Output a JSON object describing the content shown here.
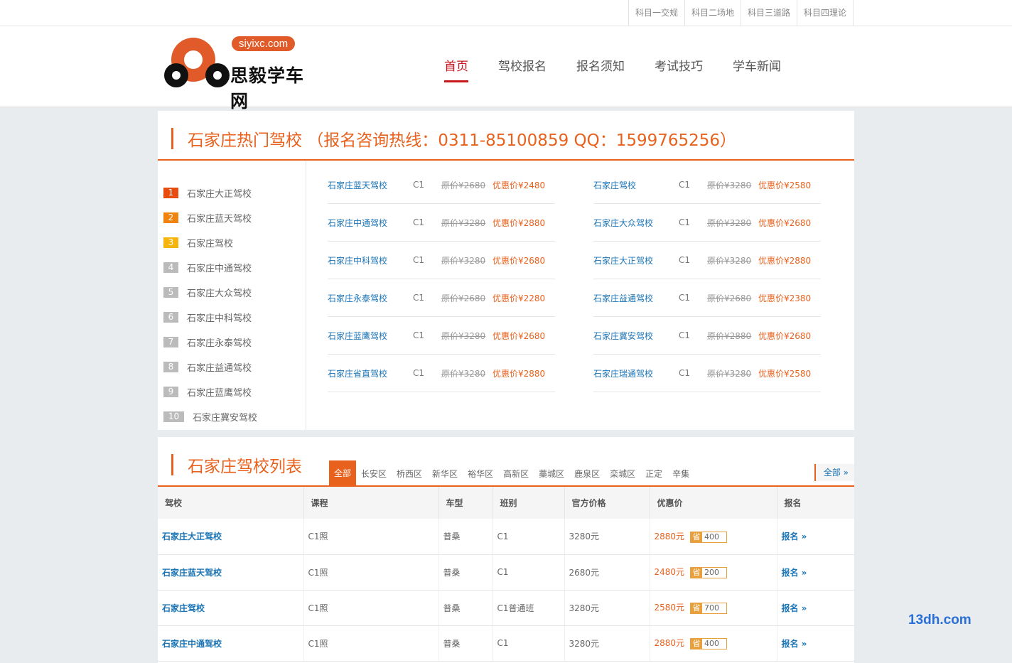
{
  "topbar": {
    "links": [
      "科目一交规",
      "科目二场地",
      "科目三道路",
      "科目四理论"
    ]
  },
  "logo": {
    "domain": "siyixc.com",
    "name": "思毅学车网"
  },
  "nav": {
    "items": [
      "首页",
      "驾校报名",
      "报名须知",
      "考试技巧",
      "学车新闻"
    ],
    "active": "首页"
  },
  "hot": {
    "title": "石家庄热门驾校 （报名咨询热线：0311-85100859 QQ：1599765256）",
    "ranking": [
      {
        "n": "1",
        "name": "石家庄大正驾校"
      },
      {
        "n": "2",
        "name": "石家庄蓝天驾校"
      },
      {
        "n": "3",
        "name": "石家庄驾校"
      },
      {
        "n": "4",
        "name": "石家庄中通驾校"
      },
      {
        "n": "5",
        "name": "石家庄大众驾校"
      },
      {
        "n": "6",
        "name": "石家庄中科驾校"
      },
      {
        "n": "7",
        "name": "石家庄永泰驾校"
      },
      {
        "n": "8",
        "name": "石家庄益通驾校"
      },
      {
        "n": "9",
        "name": "石家庄蓝鹰驾校"
      },
      {
        "n": "10",
        "name": "石家庄冀安驾校"
      }
    ],
    "offers": [
      {
        "name": "石家庄蓝天驾校",
        "cls": "C1",
        "orig": "原价¥2680",
        "disc": "优惠价¥2480"
      },
      {
        "name": "石家庄驾校",
        "cls": "C1",
        "orig": "原价¥3280",
        "disc": "优惠价¥2580"
      },
      {
        "name": "石家庄中通驾校",
        "cls": "C1",
        "orig": "原价¥3280",
        "disc": "优惠价¥2880"
      },
      {
        "name": "石家庄大众驾校",
        "cls": "C1",
        "orig": "原价¥3280",
        "disc": "优惠价¥2680"
      },
      {
        "name": "石家庄中科驾校",
        "cls": "C1",
        "orig": "原价¥3280",
        "disc": "优惠价¥2680"
      },
      {
        "name": "石家庄大正驾校",
        "cls": "C1",
        "orig": "原价¥3280",
        "disc": "优惠价¥2880"
      },
      {
        "name": "石家庄永泰驾校",
        "cls": "C1",
        "orig": "原价¥2680",
        "disc": "优惠价¥2280"
      },
      {
        "name": "石家庄益通驾校",
        "cls": "C1",
        "orig": "原价¥2680",
        "disc": "优惠价¥2380"
      },
      {
        "name": "石家庄蓝鹰驾校",
        "cls": "C1",
        "orig": "原价¥3280",
        "disc": "优惠价¥2680"
      },
      {
        "name": "石家庄冀安驾校",
        "cls": "C1",
        "orig": "原价¥2880",
        "disc": "优惠价¥2680"
      },
      {
        "name": "石家庄省直驾校",
        "cls": "C1",
        "orig": "原价¥3280",
        "disc": "优惠价¥2880"
      },
      {
        "name": "石家庄瑞通驾校",
        "cls": "C1",
        "orig": "原价¥3280",
        "disc": "优惠价¥2580"
      }
    ]
  },
  "list": {
    "title": "石家庄驾校列表",
    "filters": [
      "全部",
      "长安区",
      "桥西区",
      "新华区",
      "裕华区",
      "高新区",
      "藁城区",
      "鹿泉区",
      "栾城区",
      "正定",
      "辛集"
    ],
    "active_filter": "全部",
    "all_label": "全部 »",
    "columns": [
      "驾校",
      "课程",
      "车型",
      "班别",
      "官方价格",
      "优惠价",
      "报名"
    ],
    "rows": [
      {
        "school": "石家庄大正驾校",
        "course": "C1照",
        "car": "普桑",
        "cls": "C1",
        "price": "3280元",
        "disc": "2880元",
        "save_label": "省",
        "save": "400",
        "sign": "报名 »"
      },
      {
        "school": "石家庄蓝天驾校",
        "course": "C1照",
        "car": "普桑",
        "cls": "C1",
        "price": "2680元",
        "disc": "2480元",
        "save_label": "省",
        "save": "200",
        "sign": "报名 »"
      },
      {
        "school": "石家庄驾校",
        "course": "C1照",
        "car": "普桑",
        "cls": "C1普通班",
        "price": "3280元",
        "disc": "2580元",
        "save_label": "省",
        "save": "700",
        "sign": "报名 »"
      },
      {
        "school": "石家庄中通驾校",
        "course": "C1照",
        "car": "普桑",
        "cls": "C1",
        "price": "3280元",
        "disc": "2880元",
        "save_label": "省",
        "save": "400",
        "sign": "报名 »"
      }
    ]
  },
  "watermark": "13dh.com"
}
